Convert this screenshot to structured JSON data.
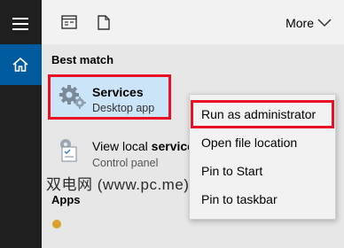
{
  "rail": {
    "menu_icon": "hamburger-menu-icon",
    "home_icon": "home-icon"
  },
  "topbar": {
    "icons": [
      "document-icon",
      "file-icon"
    ],
    "more_label": "More"
  },
  "best_match": {
    "label": "Best match",
    "title": "Services",
    "subtitle": "Desktop app",
    "icon": "services-gear-icon"
  },
  "second_result": {
    "title_prefix": "View local ",
    "title_bold": "service",
    "subtitle": "Control panel",
    "icon": "control-panel-icon"
  },
  "apps": {
    "label": "Apps"
  },
  "watermark": "双电网 (www.pc.me)",
  "context_menu": {
    "items": [
      "Run as administrator",
      "Open file location",
      "Pin to Start",
      "Pin to taskbar"
    ]
  },
  "colors": {
    "highlight_border": "#e81123",
    "selected_bg": "#cce4f7",
    "rail_bg": "#1f1f1f",
    "home_tile": "#005a9e"
  }
}
